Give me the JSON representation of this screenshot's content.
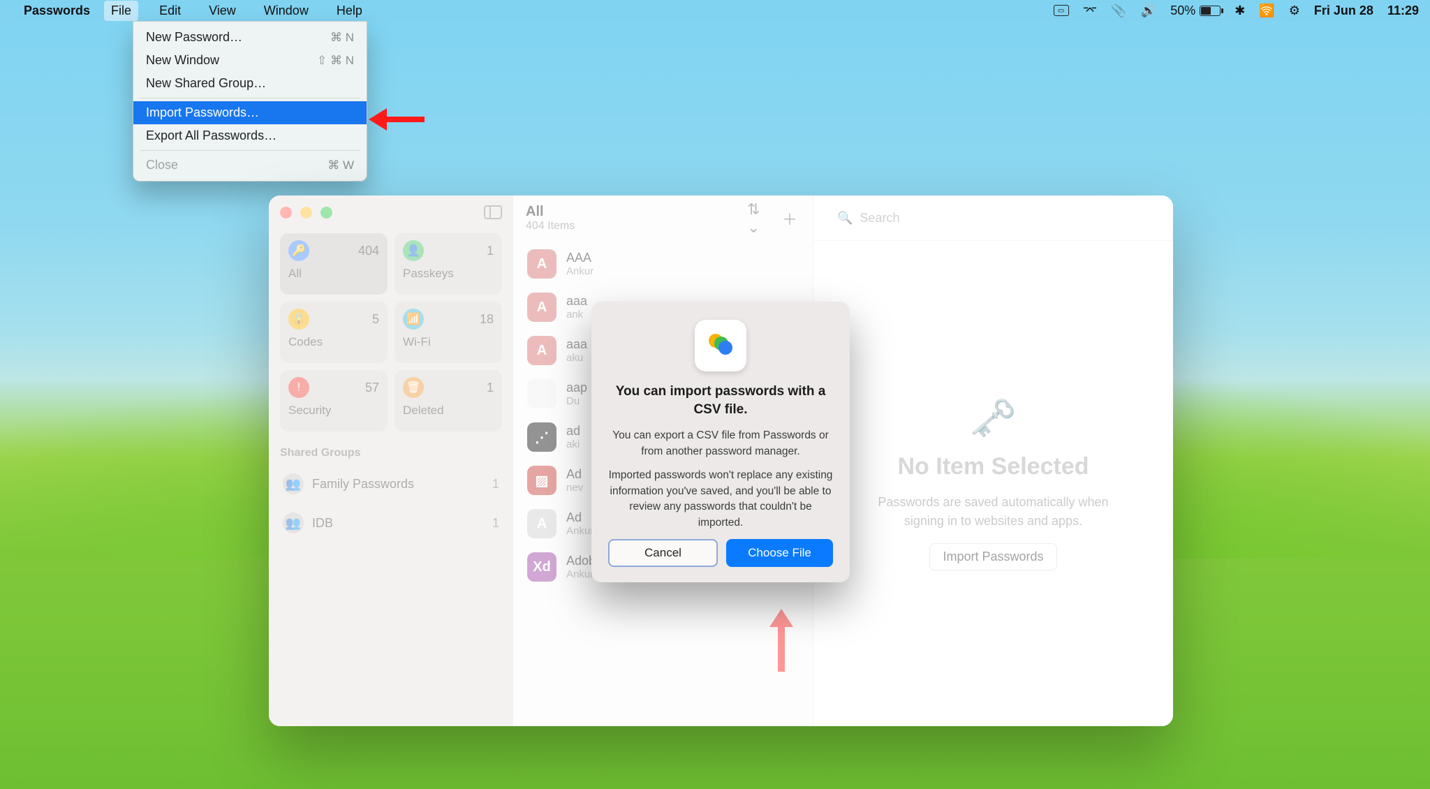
{
  "menubar": {
    "apple_icon": "",
    "app_name": "Passwords",
    "items": [
      "File",
      "Edit",
      "View",
      "Window",
      "Help"
    ],
    "open_index": 0,
    "battery_pct": "50%",
    "date": "Fri Jun 28",
    "time": "11:29"
  },
  "file_menu": {
    "rows": [
      {
        "label": "New Password…",
        "shortcut": "⌘ N"
      },
      {
        "label": "New Window",
        "shortcut": "⇧ ⌘ N"
      },
      {
        "label": "New Shared Group…",
        "shortcut": ""
      }
    ],
    "rows2": [
      {
        "label": "Import Passwords…",
        "shortcut": "",
        "selected": true
      },
      {
        "label": "Export All Passwords…",
        "shortcut": ""
      }
    ],
    "rows3": [
      {
        "label": "Close",
        "shortcut": "⌘ W",
        "disabled": true
      }
    ]
  },
  "sidebar": {
    "tiles": [
      {
        "icon": "key-icon",
        "color": "ic-blue",
        "count": "404",
        "label": "All",
        "active": true
      },
      {
        "icon": "person-icon",
        "color": "ic-green",
        "count": "1",
        "label": "Passkeys"
      },
      {
        "icon": "lock-icon",
        "color": "ic-yellow",
        "count": "5",
        "label": "Codes"
      },
      {
        "icon": "wifi-icon",
        "color": "ic-teal",
        "count": "18",
        "label": "Wi-Fi"
      },
      {
        "icon": "alert-icon",
        "color": "ic-red",
        "count": "57",
        "label": "Security"
      },
      {
        "icon": "trash-icon",
        "color": "ic-orange",
        "count": "1",
        "label": "Deleted"
      }
    ],
    "section_title": "Shared Groups",
    "groups": [
      {
        "label": "Family Passwords",
        "count": "1"
      },
      {
        "label": "IDB",
        "count": "1"
      }
    ]
  },
  "list": {
    "title": "All",
    "subtitle": "404 Items",
    "items": [
      {
        "icon": "A",
        "icon_class": "letter",
        "title": "AAA",
        "sub": "Ankur"
      },
      {
        "icon": "A",
        "icon_class": "letter",
        "title": "aaa",
        "sub": "ank"
      },
      {
        "icon": "A",
        "icon_class": "letter",
        "title": "aaa",
        "sub": "aku"
      },
      {
        "icon": "",
        "icon_class": "apple-ic",
        "title": "aap",
        "sub": "Du"
      },
      {
        "icon": "⋰",
        "icon_class": "adidas-ic",
        "title": "ad",
        "sub": "aki"
      },
      {
        "icon": "▨",
        "icon_class": "red-sq",
        "title": "Ad",
        "sub": "nev"
      },
      {
        "icon": "A",
        "icon_class": "grey-sq",
        "title": "Ad",
        "sub": "Ankur Thakur"
      },
      {
        "icon": "Xd",
        "icon_class": "xd-sq",
        "title": "Adobe XD",
        "sub": "Ankur Thakur"
      }
    ]
  },
  "detail": {
    "search_placeholder": "Search",
    "empty_title": "No Item Selected",
    "empty_desc": "Passwords are saved automatically when signing in to websites and apps.",
    "import_btn": "Import Passwords"
  },
  "modal": {
    "title": "You can import passwords with a CSV file.",
    "p1": "You can export a CSV file from Passwords or from another password manager.",
    "p2": "Imported passwords won't replace any existing information you've saved, and you'll be able to review any passwords that couldn't be imported.",
    "cancel": "Cancel",
    "choose": "Choose File"
  }
}
